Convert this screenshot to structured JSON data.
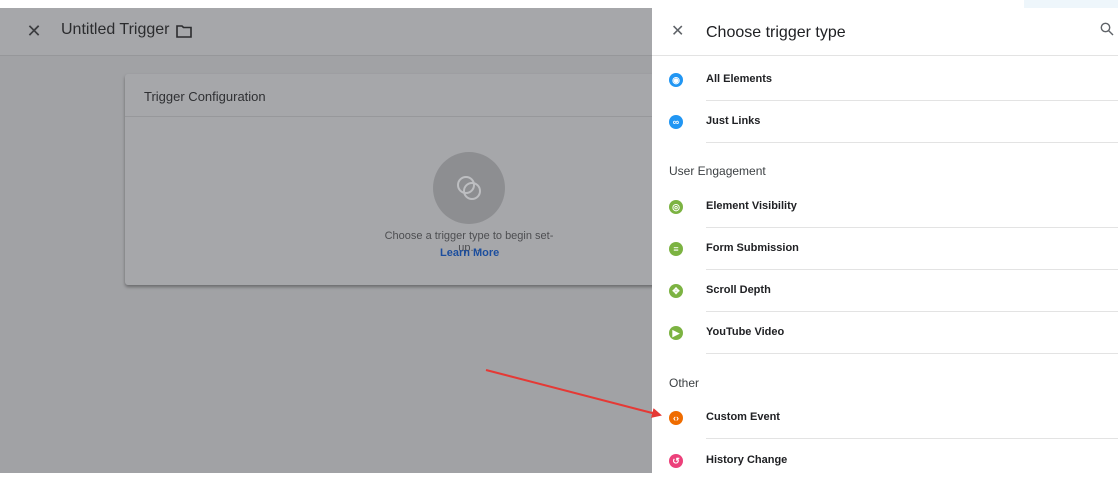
{
  "editor": {
    "title": "Untitled Trigger",
    "card": {
      "title": "Trigger Configuration",
      "message": "Choose a trigger type to begin set-up...",
      "link": "Learn More"
    }
  },
  "panel": {
    "title": "Choose trigger type",
    "groups": [
      {
        "items": [
          {
            "label": "All Elements",
            "icon": "cursor-click-icon",
            "color": "#2196f3"
          },
          {
            "label": "Just Links",
            "icon": "link-icon",
            "color": "#2196f3"
          }
        ]
      },
      {
        "heading": "User Engagement",
        "items": [
          {
            "label": "Element Visibility",
            "icon": "eye-icon",
            "color": "#7cb342"
          },
          {
            "label": "Form Submission",
            "icon": "form-check-icon",
            "color": "#7cb342"
          },
          {
            "label": "Scroll Depth",
            "icon": "scroll-arrows-icon",
            "color": "#7cb342"
          },
          {
            "label": "YouTube Video",
            "icon": "play-icon",
            "color": "#7cb342"
          }
        ]
      },
      {
        "heading": "Other",
        "items": [
          {
            "label": "Custom Event",
            "icon": "code-brackets-icon",
            "color": "#ef6c00"
          },
          {
            "label": "History Change",
            "icon": "history-icon",
            "color": "#ec407a"
          }
        ]
      }
    ]
  },
  "colors": {
    "arrow": "#e53935",
    "link": "#1a73e8"
  }
}
